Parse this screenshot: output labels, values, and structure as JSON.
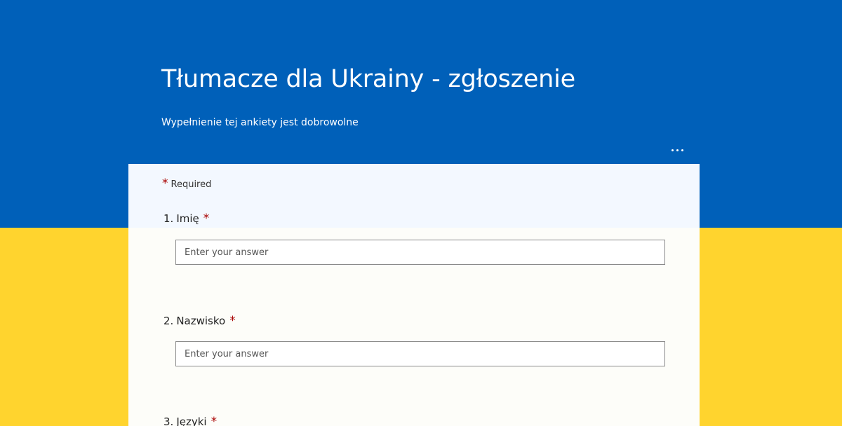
{
  "header": {
    "title": "Tłumacze dla Ukrainy - zgłoszenie",
    "subtitle": "Wypełnienie tej ankiety jest dobrowolne",
    "more_icon": "more-horizontal-icon"
  },
  "colors": {
    "flag_blue": "#0060b9",
    "flag_yellow": "#ffd42e",
    "required_star": "#a80000"
  },
  "form": {
    "required_star": "*",
    "required_label": "Required",
    "questions": [
      {
        "number": "1.",
        "label": "Imię",
        "required_mark": "*",
        "placeholder": "Enter your answer",
        "value": ""
      },
      {
        "number": "2.",
        "label": "Nazwisko",
        "required_mark": "*",
        "placeholder": "Enter your answer",
        "value": ""
      },
      {
        "number": "3.",
        "label": "Języki",
        "required_mark": "*"
      }
    ]
  }
}
